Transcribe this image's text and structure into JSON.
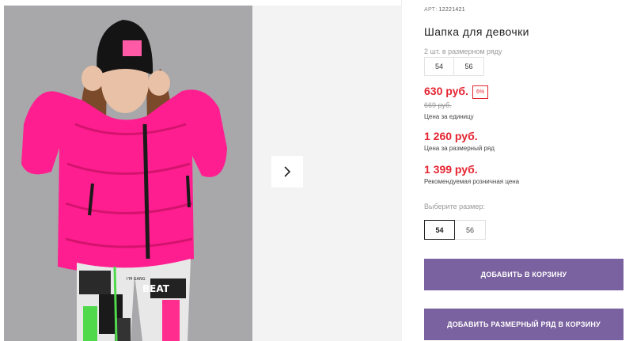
{
  "gallery": {
    "next_icon": "chevron-right-icon",
    "hat_badge_color": "#ff5aa6",
    "jacket_color": "#ff1e8f",
    "pants_text_1": "BEAT",
    "pants_text_2": "I'M GANG"
  },
  "product": {
    "art_label": "АРТ:",
    "art_number": "12221421",
    "title": "Шапка для девочки",
    "series_label": "2 шт. в размерном ряду",
    "series_sizes": [
      "54",
      "56"
    ],
    "price": "630 руб.",
    "discount": "6%",
    "old_price": "669 руб.",
    "price_note": "Цена за единицу",
    "series_price": "1 260 руб.",
    "series_price_note": "Цена за размерный ряд",
    "retail_price": "1 399 руб.",
    "retail_note": "Рекомендуемая розничная цена",
    "size_label": "Выберите размер:",
    "sizes": [
      {
        "label": "54",
        "selected": true
      },
      {
        "label": "56",
        "selected": false
      }
    ]
  },
  "actions": {
    "add_to_cart": "ДОБАВИТЬ В КОРЗИНУ",
    "add_series_to_cart": "ДОБАВИТЬ РАЗМЕРНЫЙ РЯД В КОРЗИНУ"
  },
  "colors": {
    "accent_red": "#e52431",
    "button_purple": "#7a619f"
  }
}
